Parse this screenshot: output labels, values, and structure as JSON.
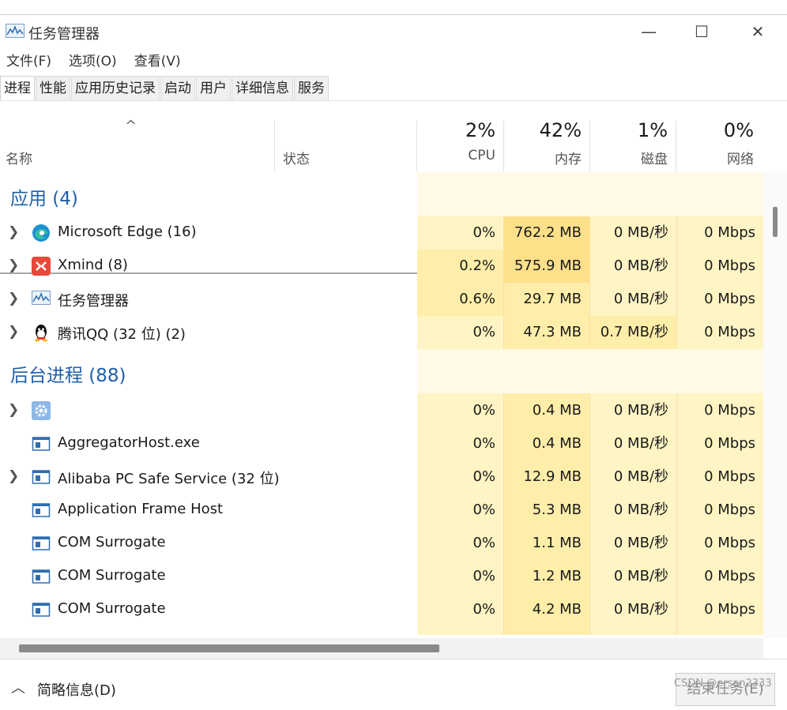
{
  "window": {
    "title": "任务管理器",
    "minimize": "—",
    "maximize": "☐",
    "close": "✕"
  },
  "menu": [
    "文件(F)",
    "选项(O)",
    "查看(V)"
  ],
  "tabs": [
    "进程",
    "性能",
    "应用历史记录",
    "启动",
    "用户",
    "详细信息",
    "服务"
  ],
  "active_tab": "进程",
  "columns": {
    "name": "名称",
    "status": "状态",
    "cpu": {
      "pct": "2%",
      "label": "CPU"
    },
    "mem": {
      "pct": "42%",
      "label": "内存"
    },
    "disk": {
      "pct": "1%",
      "label": "磁盘"
    },
    "net": {
      "pct": "0%",
      "label": "网络"
    }
  },
  "groups": {
    "apps": "应用 (4)",
    "background": "后台进程 (88)"
  },
  "apps": [
    {
      "name": "Microsoft Edge (16)",
      "icon": "edge-icon",
      "expandable": true,
      "cpu": "0%",
      "mem": "762.2 MB",
      "disk": "0 MB/秒",
      "net": "0 Mbps"
    },
    {
      "name": "Xmind (8)",
      "icon": "xmind-icon",
      "expandable": true,
      "cpu": "0.2%",
      "mem": "575.9 MB",
      "disk": "0 MB/秒",
      "net": "0 Mbps"
    },
    {
      "name": "任务管理器",
      "icon": "task-manager-icon",
      "expandable": true,
      "cpu": "0.6%",
      "mem": "29.7 MB",
      "disk": "0 MB/秒",
      "net": "0 Mbps"
    },
    {
      "name": "腾讯QQ (32 位) (2)",
      "icon": "qq-icon",
      "expandable": true,
      "cpu": "0%",
      "mem": "47.3 MB",
      "disk": "0.7 MB/秒",
      "net": "0 Mbps"
    }
  ],
  "background": [
    {
      "name": "",
      "icon": "gear-icon",
      "expandable": true,
      "cpu": "0%",
      "mem": "0.4 MB",
      "disk": "0 MB/秒",
      "net": "0 Mbps"
    },
    {
      "name": "AggregatorHost.exe",
      "icon": "process-icon",
      "expandable": false,
      "cpu": "0%",
      "mem": "0.4 MB",
      "disk": "0 MB/秒",
      "net": "0 Mbps"
    },
    {
      "name": "Alibaba PC Safe Service (32 位)",
      "icon": "process-icon",
      "expandable": true,
      "cpu": "0%",
      "mem": "12.9 MB",
      "disk": "0 MB/秒",
      "net": "0 Mbps"
    },
    {
      "name": "Application Frame Host",
      "icon": "process-icon",
      "expandable": false,
      "cpu": "0%",
      "mem": "5.3 MB",
      "disk": "0 MB/秒",
      "net": "0 Mbps"
    },
    {
      "name": "COM Surrogate",
      "icon": "process-icon",
      "expandable": false,
      "cpu": "0%",
      "mem": "1.1 MB",
      "disk": "0 MB/秒",
      "net": "0 Mbps"
    },
    {
      "name": "COM Surrogate",
      "icon": "process-icon",
      "expandable": false,
      "cpu": "0%",
      "mem": "1.2 MB",
      "disk": "0 MB/秒",
      "net": "0 Mbps"
    },
    {
      "name": "COM Surrogate",
      "icon": "process-icon",
      "expandable": false,
      "cpu": "0%",
      "mem": "4.2 MB",
      "disk": "0 MB/秒",
      "net": "0 Mbps"
    }
  ],
  "footer": {
    "brief": "简略信息(D)",
    "end_task": "结束任务(E)"
  },
  "watermark": "CSDN @ersan2333",
  "colors": {
    "heat_light": "#fff4c4",
    "heat_mid": "#ffeeaa",
    "heat_strong": "#ffe08a",
    "heat_pale": "#fffae6",
    "group_text": "#1f5fa8"
  }
}
